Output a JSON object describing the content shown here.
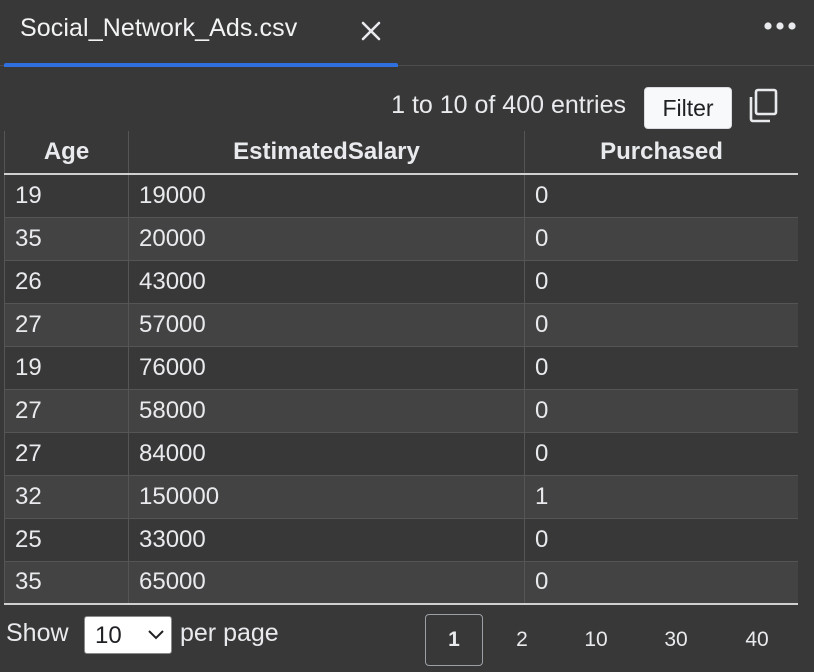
{
  "tab": {
    "title": "Social_Network_Ads.csv",
    "close_icon": "close-icon"
  },
  "toolbar": {
    "more_icon": "more-horizontal-icon",
    "entries_text": "1 to 10 of 400 entries",
    "filter_label": "Filter",
    "copy_icon": "copy-icon"
  },
  "table": {
    "columns": [
      "Age",
      "EstimatedSalary",
      "Purchased"
    ],
    "rows": [
      [
        "19",
        "19000",
        "0"
      ],
      [
        "35",
        "20000",
        "0"
      ],
      [
        "26",
        "43000",
        "0"
      ],
      [
        "27",
        "57000",
        "0"
      ],
      [
        "19",
        "76000",
        "0"
      ],
      [
        "27",
        "58000",
        "0"
      ],
      [
        "27",
        "84000",
        "0"
      ],
      [
        "32",
        "150000",
        "1"
      ],
      [
        "25",
        "33000",
        "0"
      ],
      [
        "35",
        "65000",
        "0"
      ]
    ]
  },
  "footer": {
    "show_label": "Show",
    "per_page_value": "10",
    "per_page_label": "per page",
    "pages": [
      "1",
      "2",
      "10",
      "30",
      "40"
    ],
    "active_page": "1"
  },
  "colors": {
    "background": "#383838",
    "row_alt": "#434343",
    "accent": "#2f6fde"
  }
}
